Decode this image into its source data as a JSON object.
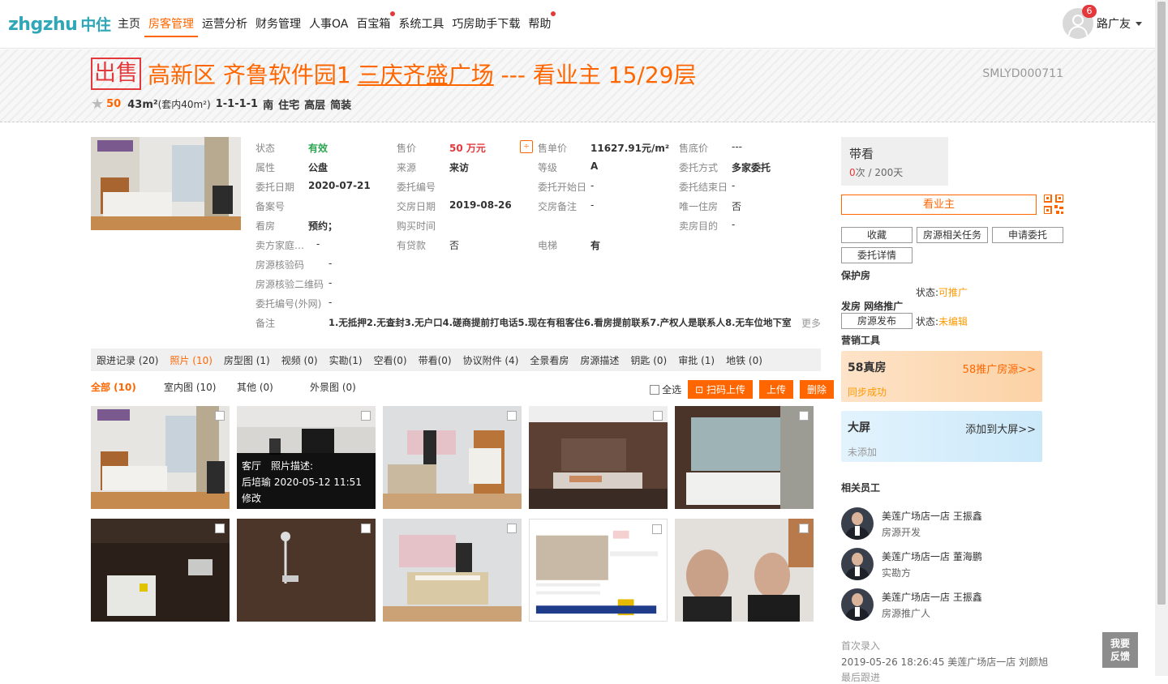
{
  "brand": {
    "logo_text": "zhgzhu",
    "logo_cn": "中住"
  },
  "nav": [
    {
      "label": "主页",
      "active": false,
      "dot": false
    },
    {
      "label": "房客管理",
      "active": true,
      "dot": false
    },
    {
      "label": "运营分析",
      "active": false,
      "dot": false
    },
    {
      "label": "财务管理",
      "active": false,
      "dot": false
    },
    {
      "label": "人事OA",
      "active": false,
      "dot": false
    },
    {
      "label": "百宝箱",
      "active": false,
      "dot": true
    },
    {
      "label": "系统工具",
      "active": false,
      "dot": false
    },
    {
      "label": "巧房助手下载",
      "active": false,
      "dot": false
    },
    {
      "label": "帮助",
      "active": false,
      "dot": true
    }
  ],
  "user": {
    "name": "路广友",
    "badge": "6"
  },
  "listing": {
    "tag": "出售",
    "district": "高新区",
    "area_name": "齐鲁软件园1",
    "community": "三庆齐盛广场",
    "suffix": "--- 看业主 15/29层",
    "code": "SMLYD000711",
    "score": "50",
    "size": "43m²",
    "size_inner": "(套内40m²)",
    "layout": "1-1-1-1",
    "facing": "南",
    "usage": "住宅",
    "floor": "高层",
    "decor": "简装"
  },
  "details": {
    "status_l": "状态",
    "status_v": "有效",
    "price_l": "售价",
    "price_v": "50 万元",
    "unit_l": "售单价",
    "unit_v": "11627.91元/m²",
    "floorprice_l": "售底价",
    "floorprice_v": "---",
    "attr_l": "属性",
    "attr_v": "公盘",
    "source_l": "来源",
    "source_v": "来访",
    "grade_l": "等级",
    "grade_v": "A",
    "entrust_l": "委托方式",
    "entrust_v": "多家委托",
    "edate_l": "委托日期",
    "edate_v": "2020-07-21",
    "eno_l": "委托编号",
    "estart_l": "委托开始日",
    "estart_v": "-",
    "eend_l": "委托结束日",
    "eend_v": "-",
    "record_l": "备案号",
    "handover_l": "交房日期",
    "handover_v": "2019-08-26",
    "hnote_l": "交房备注",
    "hnote_v": "-",
    "only_l": "唯一住房",
    "only_v": "否",
    "view_l": "看房",
    "view_v": "预约；",
    "buytime_l": "购买时间",
    "purpose_l": "卖房目的",
    "purpose_v": "-",
    "family_l": "卖方家庭…",
    "family_v": "-",
    "loan_l": "有贷款",
    "loan_v": "否",
    "elev_l": "电梯",
    "elev_v": "有",
    "vcode_l": "房源核验码",
    "vcode_v": "-",
    "vqr_l": "房源核验二维码",
    "vqr_v": "-",
    "eno_ext_l": "委托编号(外网)",
    "eno_ext_v": "-",
    "remark_l": "备注",
    "remark_v": "1.无抵押2.无查封3.无户口4.磋商提前打电话5.现在有租客住6.看房提前联系7.产权人是联系人8.无车位地下室",
    "more": "更多"
  },
  "tabs": [
    {
      "label": "跟进记录 (20)",
      "on": false
    },
    {
      "label": "照片 (10)",
      "on": true
    },
    {
      "label": "房型图 (1)",
      "on": false
    },
    {
      "label": "视频 (0)",
      "on": false
    },
    {
      "label": "实勘(1)",
      "on": false
    },
    {
      "label": "空看(0)",
      "on": false
    },
    {
      "label": "带看(0)",
      "on": false
    },
    {
      "label": "协议附件 (4)",
      "on": false
    },
    {
      "label": "全景看房",
      "on": false
    },
    {
      "label": "房源描述",
      "on": false
    },
    {
      "label": "钥匙 (0)",
      "on": false
    },
    {
      "label": "审批 (1)",
      "on": false
    },
    {
      "label": "地铁 (0)",
      "on": false
    }
  ],
  "subtabs": [
    {
      "label": "全部 (10)",
      "on": true
    },
    {
      "label": "室内图 (10)",
      "on": false
    },
    {
      "label": "其他 (0)",
      "on": false
    },
    {
      "label": "外景图 (0)",
      "on": false
    }
  ],
  "photo_tools": {
    "select_all": "全选",
    "scan_upload": "扫码上传",
    "upload": "上传",
    "delete": "删除"
  },
  "photo_overlay": {
    "line1": "客厅　照片描述:",
    "line2": "后培瑜 2020-05-12 11:51",
    "line3": "修改"
  },
  "side": {
    "daikan_title": "带看",
    "daikan_zero": "0",
    "daikan_rest": "次 / 200天",
    "look_owner": "看业主",
    "fav": "收藏",
    "tasks": "房源相关任务",
    "apply": "申请委托",
    "edetail": "委托详情",
    "protect": "保护房",
    "status_l": "状态:",
    "status_v1": "可推广",
    "publish_title": "发房 网络推广",
    "publish_btn": "房源发布",
    "status_v2": "未编辑",
    "marketing": "营销工具",
    "c1_title": "58真房",
    "c1_link": "58推广房源>>",
    "c1_status": "同步成功",
    "c2_title": "大屏",
    "c2_link": "添加到大屏>>",
    "c2_status": "未添加",
    "staff_title": "相关员工",
    "staff": [
      {
        "store": "美莲广场店一店 王振鑫",
        "role": "房源开发"
      },
      {
        "store": "美莲广场店一店 董海鹏",
        "role": "实勘方"
      },
      {
        "store": "美莲广场店一店 王振鑫",
        "role": "房源推广人"
      }
    ],
    "first_entry_l": "首次录入",
    "first_entry_v": "2019-05-26 18:26:45 美莲广场店一店 刘颜旭",
    "last_follow": "最后跟进"
  },
  "feedback": {
    "l1": "我要",
    "l2": "反馈"
  },
  "colors": {
    "accent": "#ff6600",
    "brand": "#2fa7b8",
    "status_green": "#2ca54f",
    "price_red": "#e4393c"
  }
}
